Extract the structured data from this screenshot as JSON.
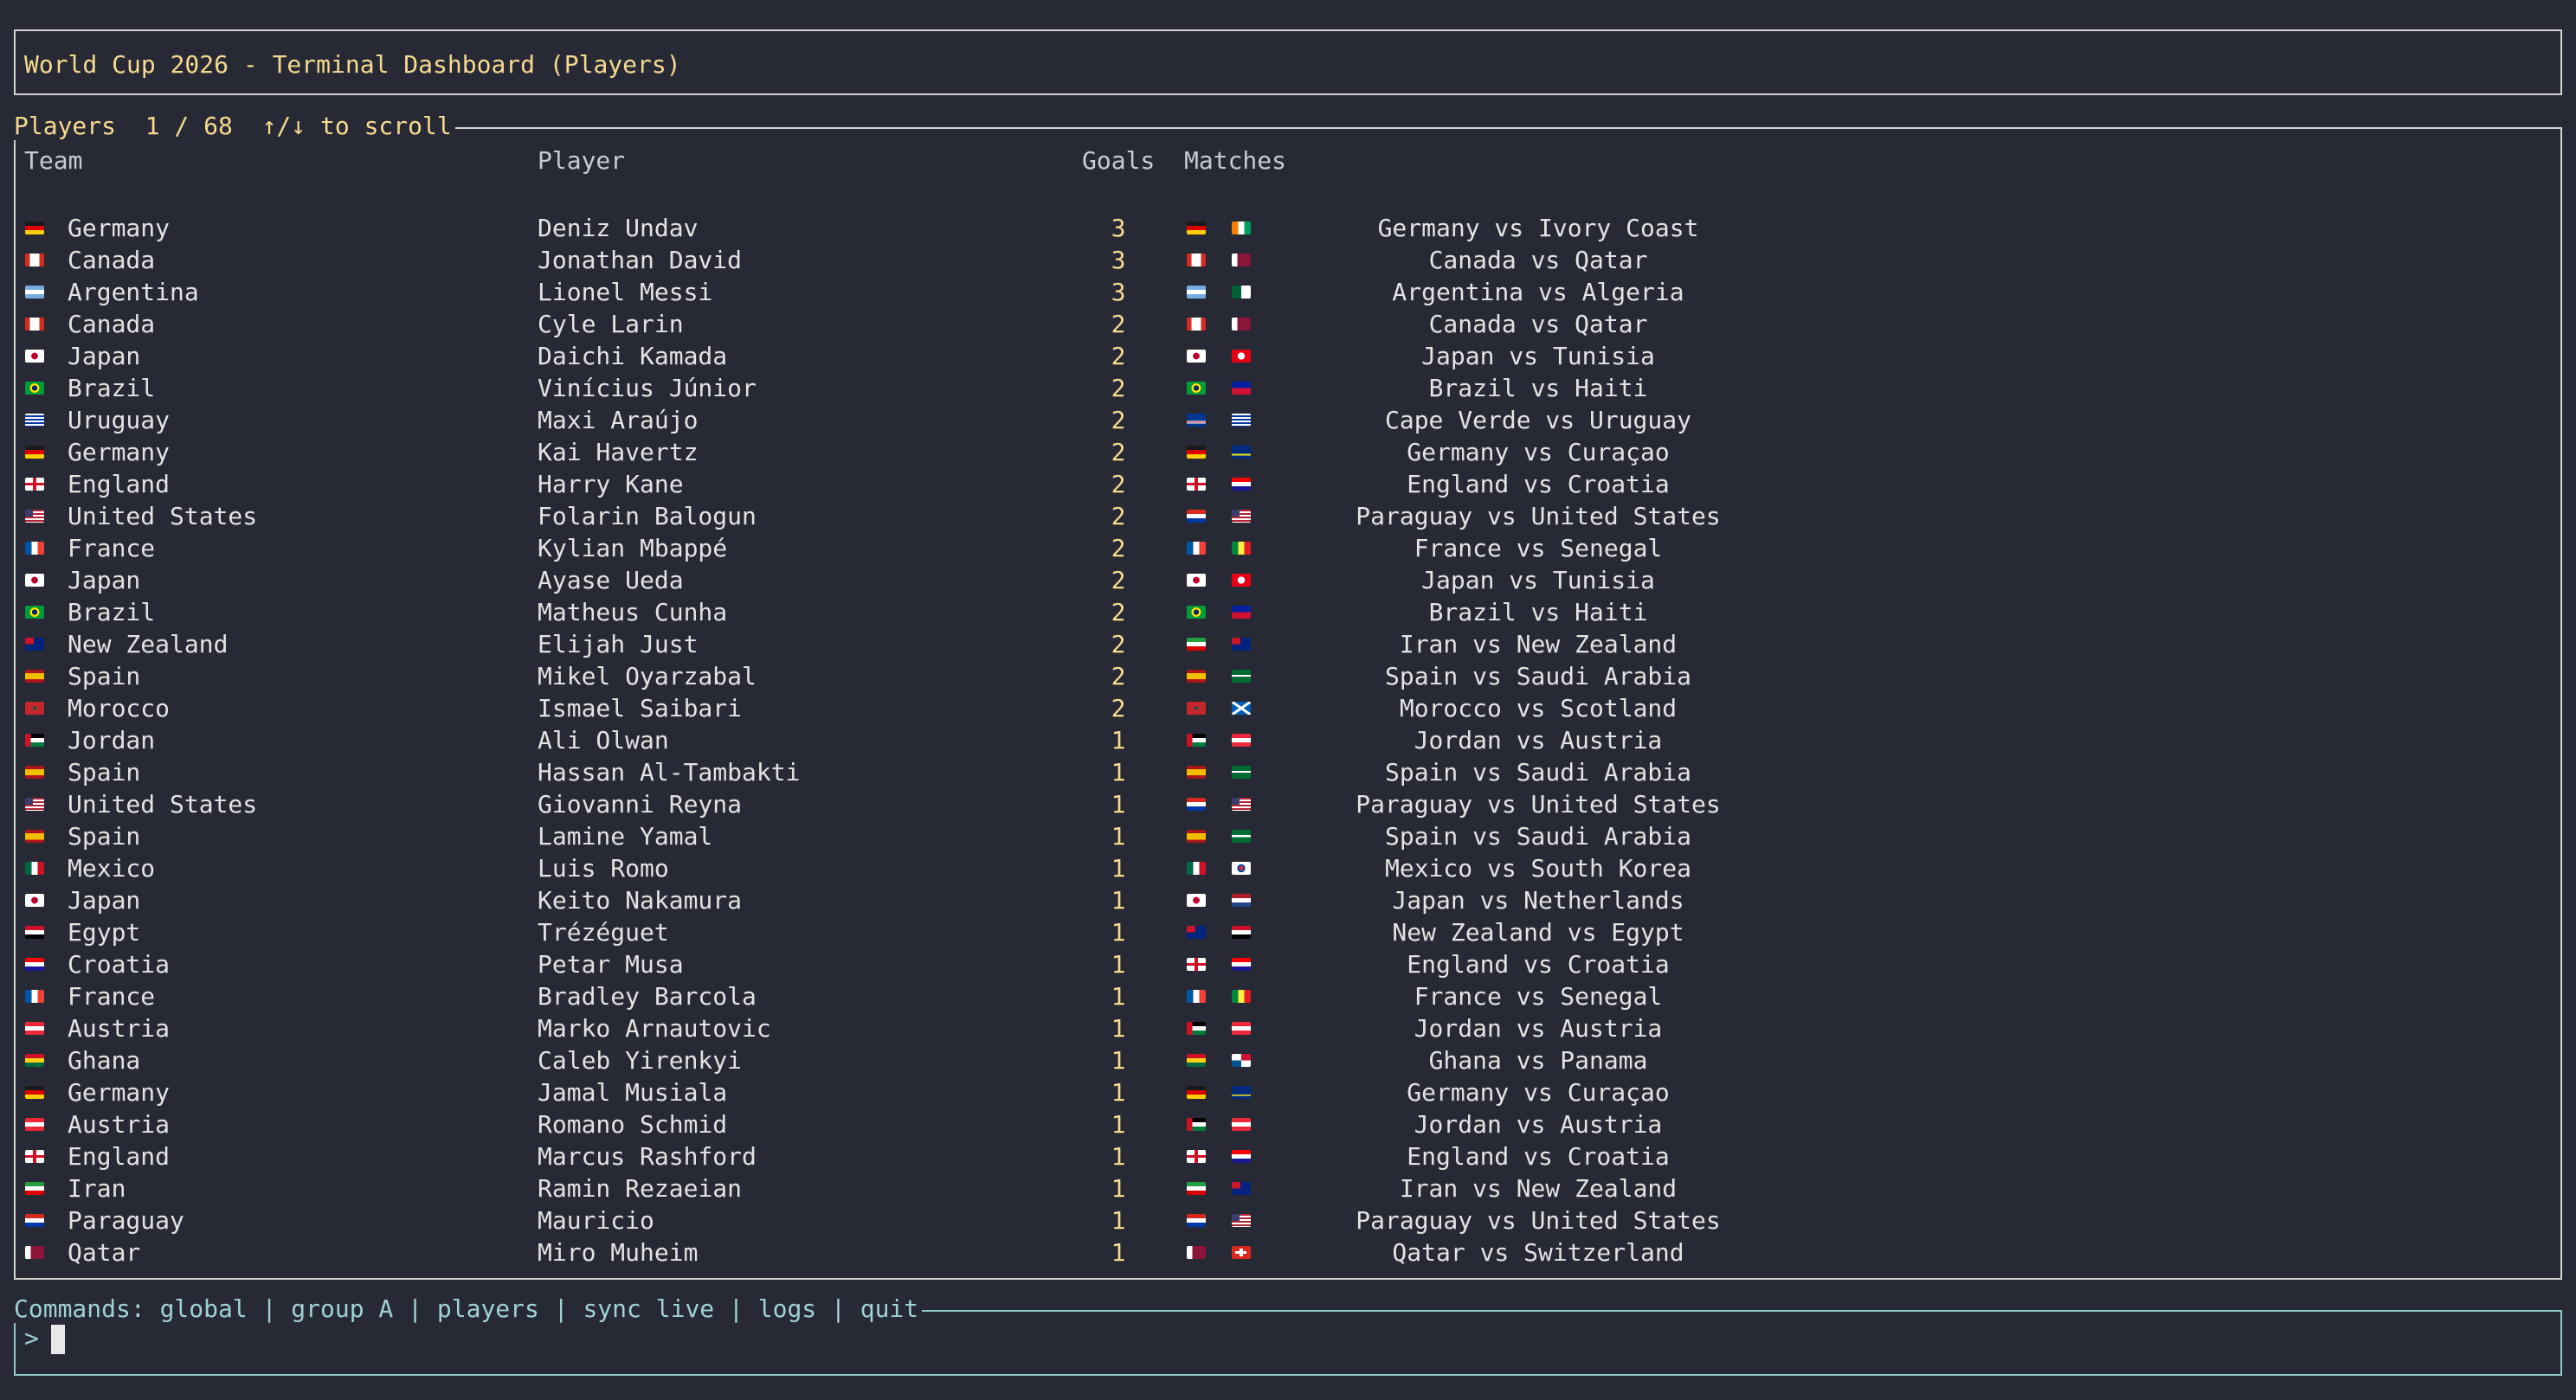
{
  "title": "World Cup 2026 - Terminal Dashboard (Players)",
  "players_panel": {
    "title": "Players  1 / 68  ↑/↓ to scroll",
    "headers": {
      "team": "Team",
      "player": "Player",
      "goals": "Goals",
      "matches": "Matches"
    },
    "rows": [
      {
        "team": "Germany",
        "player": "Deniz Undav",
        "goals": "3",
        "match": "Germany vs Ivory Coast",
        "team_flag": "germany-flag-icon",
        "home_flag": "germany-flag-icon",
        "away_flag": "ivory-coast-flag-icon"
      },
      {
        "team": "Canada",
        "player": "Jonathan David",
        "goals": "3",
        "match": "Canada vs Qatar",
        "team_flag": "canada-flag-icon",
        "home_flag": "canada-flag-icon",
        "away_flag": "qatar-flag-icon"
      },
      {
        "team": "Argentina",
        "player": "Lionel Messi",
        "goals": "3",
        "match": "Argentina vs Algeria",
        "team_flag": "argentina-flag-icon",
        "home_flag": "argentina-flag-icon",
        "away_flag": "algeria-flag-icon"
      },
      {
        "team": "Canada",
        "player": "Cyle Larin",
        "goals": "2",
        "match": "Canada vs Qatar",
        "team_flag": "canada-flag-icon",
        "home_flag": "canada-flag-icon",
        "away_flag": "qatar-flag-icon"
      },
      {
        "team": "Japan",
        "player": "Daichi Kamada",
        "goals": "2",
        "match": "Japan vs Tunisia",
        "team_flag": "japan-flag-icon",
        "home_flag": "japan-flag-icon",
        "away_flag": "tunisia-flag-icon"
      },
      {
        "team": "Brazil",
        "player": "Vinícius Júnior",
        "goals": "2",
        "match": "Brazil vs Haiti",
        "team_flag": "brazil-flag-icon",
        "home_flag": "brazil-flag-icon",
        "away_flag": "haiti-flag-icon"
      },
      {
        "team": "Uruguay",
        "player": "Maxi Araújo",
        "goals": "2",
        "match": "Cape Verde vs Uruguay",
        "team_flag": "uruguay-flag-icon",
        "home_flag": "cape-verde-flag-icon",
        "away_flag": "uruguay-flag-icon"
      },
      {
        "team": "Germany",
        "player": "Kai Havertz",
        "goals": "2",
        "match": "Germany vs Curaçao",
        "team_flag": "germany-flag-icon",
        "home_flag": "germany-flag-icon",
        "away_flag": "curacao-flag-icon"
      },
      {
        "team": "England",
        "player": "Harry Kane",
        "goals": "2",
        "match": "England vs Croatia",
        "team_flag": "england-flag-icon",
        "home_flag": "england-flag-icon",
        "away_flag": "croatia-flag-icon"
      },
      {
        "team": "United States",
        "player": "Folarin Balogun",
        "goals": "2",
        "match": "Paraguay vs United States",
        "team_flag": "usa-flag-icon",
        "home_flag": "paraguay-flag-icon",
        "away_flag": "usa-flag-icon"
      },
      {
        "team": "France",
        "player": "Kylian Mbappé",
        "goals": "2",
        "match": "France vs Senegal",
        "team_flag": "france-flag-icon",
        "home_flag": "france-flag-icon",
        "away_flag": "senegal-flag-icon"
      },
      {
        "team": "Japan",
        "player": "Ayase Ueda",
        "goals": "2",
        "match": "Japan vs Tunisia",
        "team_flag": "japan-flag-icon",
        "home_flag": "japan-flag-icon",
        "away_flag": "tunisia-flag-icon"
      },
      {
        "team": "Brazil",
        "player": "Matheus Cunha",
        "goals": "2",
        "match": "Brazil vs Haiti",
        "team_flag": "brazil-flag-icon",
        "home_flag": "brazil-flag-icon",
        "away_flag": "haiti-flag-icon"
      },
      {
        "team": "New Zealand",
        "player": "Elijah Just",
        "goals": "2",
        "match": "Iran vs New Zealand",
        "team_flag": "new-zealand-flag-icon",
        "home_flag": "iran-flag-icon",
        "away_flag": "new-zealand-flag-icon"
      },
      {
        "team": "Spain",
        "player": "Mikel Oyarzabal",
        "goals": "2",
        "match": "Spain vs Saudi Arabia",
        "team_flag": "spain-flag-icon",
        "home_flag": "spain-flag-icon",
        "away_flag": "saudi-arabia-flag-icon"
      },
      {
        "team": "Morocco",
        "player": "Ismael Saibari",
        "goals": "2",
        "match": "Morocco vs Scotland",
        "team_flag": "morocco-flag-icon",
        "home_flag": "morocco-flag-icon",
        "away_flag": "scotland-flag-icon"
      },
      {
        "team": "Jordan",
        "player": "Ali Olwan",
        "goals": "1",
        "match": "Jordan vs Austria",
        "team_flag": "jordan-flag-icon",
        "home_flag": "jordan-flag-icon",
        "away_flag": "austria-flag-icon"
      },
      {
        "team": "Spain",
        "player": "Hassan Al-Tambakti",
        "goals": "1",
        "match": "Spain vs Saudi Arabia",
        "team_flag": "spain-flag-icon",
        "home_flag": "spain-flag-icon",
        "away_flag": "saudi-arabia-flag-icon"
      },
      {
        "team": "United States",
        "player": "Giovanni Reyna",
        "goals": "1",
        "match": "Paraguay vs United States",
        "team_flag": "usa-flag-icon",
        "home_flag": "paraguay-flag-icon",
        "away_flag": "usa-flag-icon"
      },
      {
        "team": "Spain",
        "player": "Lamine Yamal",
        "goals": "1",
        "match": "Spain vs Saudi Arabia",
        "team_flag": "spain-flag-icon",
        "home_flag": "spain-flag-icon",
        "away_flag": "saudi-arabia-flag-icon"
      },
      {
        "team": "Mexico",
        "player": "Luis Romo",
        "goals": "1",
        "match": "Mexico vs South Korea",
        "team_flag": "mexico-flag-icon",
        "home_flag": "mexico-flag-icon",
        "away_flag": "south-korea-flag-icon"
      },
      {
        "team": "Japan",
        "player": "Keito Nakamura",
        "goals": "1",
        "match": "Japan vs Netherlands",
        "team_flag": "japan-flag-icon",
        "home_flag": "japan-flag-icon",
        "away_flag": "netherlands-flag-icon"
      },
      {
        "team": "Egypt",
        "player": "Trézéguet",
        "goals": "1",
        "match": "New Zealand vs Egypt",
        "team_flag": "egypt-flag-icon",
        "home_flag": "new-zealand-flag-icon",
        "away_flag": "egypt-flag-icon"
      },
      {
        "team": "Croatia",
        "player": "Petar Musa",
        "goals": "1",
        "match": "England vs Croatia",
        "team_flag": "croatia-flag-icon",
        "home_flag": "england-flag-icon",
        "away_flag": "croatia-flag-icon"
      },
      {
        "team": "France",
        "player": "Bradley Barcola",
        "goals": "1",
        "match": "France vs Senegal",
        "team_flag": "france-flag-icon",
        "home_flag": "france-flag-icon",
        "away_flag": "senegal-flag-icon"
      },
      {
        "team": "Austria",
        "player": "Marko Arnautovic",
        "goals": "1",
        "match": "Jordan vs Austria",
        "team_flag": "austria-flag-icon",
        "home_flag": "jordan-flag-icon",
        "away_flag": "austria-flag-icon"
      },
      {
        "team": "Ghana",
        "player": "Caleb Yirenkyi",
        "goals": "1",
        "match": "Ghana vs Panama",
        "team_flag": "ghana-flag-icon",
        "home_flag": "ghana-flag-icon",
        "away_flag": "panama-flag-icon"
      },
      {
        "team": "Germany",
        "player": "Jamal Musiala",
        "goals": "1",
        "match": "Germany vs Curaçao",
        "team_flag": "germany-flag-icon",
        "home_flag": "germany-flag-icon",
        "away_flag": "curacao-flag-icon"
      },
      {
        "team": "Austria",
        "player": "Romano Schmid",
        "goals": "1",
        "match": "Jordan vs Austria",
        "team_flag": "austria-flag-icon",
        "home_flag": "jordan-flag-icon",
        "away_flag": "austria-flag-icon"
      },
      {
        "team": "England",
        "player": "Marcus Rashford",
        "goals": "1",
        "match": "England vs Croatia",
        "team_flag": "england-flag-icon",
        "home_flag": "england-flag-icon",
        "away_flag": "croatia-flag-icon"
      },
      {
        "team": "Iran",
        "player": "Ramin Rezaeian",
        "goals": "1",
        "match": "Iran vs New Zealand",
        "team_flag": "iran-flag-icon",
        "home_flag": "iran-flag-icon",
        "away_flag": "new-zealand-flag-icon"
      },
      {
        "team": "Paraguay",
        "player": "Mauricio",
        "goals": "1",
        "match": "Paraguay vs United States",
        "team_flag": "paraguay-flag-icon",
        "home_flag": "paraguay-flag-icon",
        "away_flag": "usa-flag-icon"
      },
      {
        "team": "Qatar",
        "player": "Miro Muheim",
        "goals": "1",
        "match": "Qatar vs Switzerland",
        "team_flag": "qatar-flag-icon",
        "home_flag": "qatar-flag-icon",
        "away_flag": "switzerland-flag-icon"
      }
    ]
  },
  "commands_panel": {
    "title": "Commands: global | group A | players | sync live | logs | quit",
    "prompt": ">"
  },
  "colors": {
    "background": "#272a34",
    "title_text": "#f7d98f",
    "goals_text": "#f7d98f",
    "commands_border": "#8fc9c9",
    "panel_border": "#d4d4d4"
  }
}
